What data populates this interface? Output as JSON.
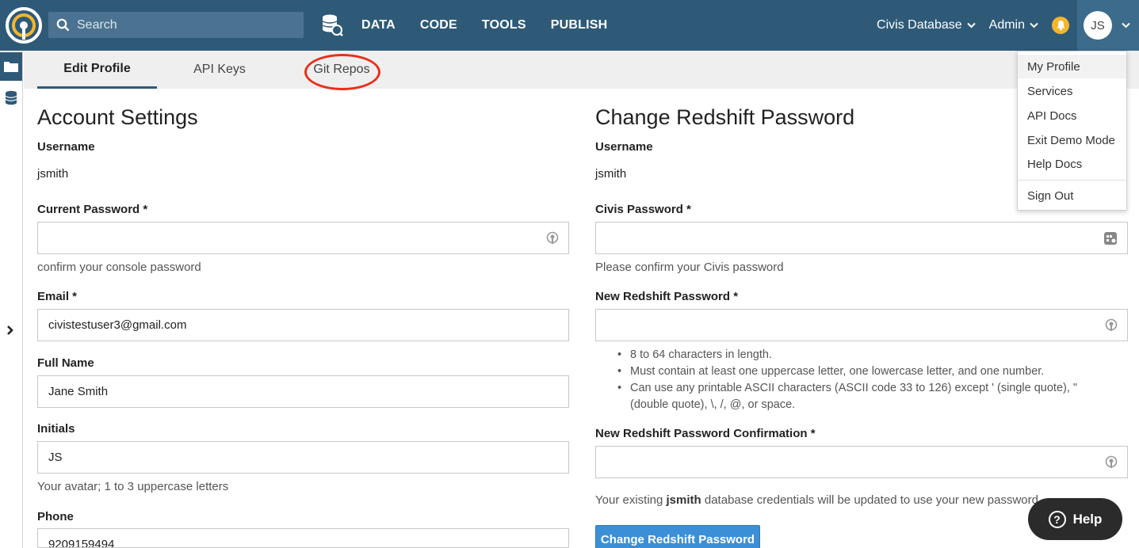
{
  "nav": {
    "search_placeholder": "Search",
    "links": [
      "DATA",
      "CODE",
      "TOOLS",
      "PUBLISH"
    ],
    "database_label": "Civis Database",
    "admin_label": "Admin",
    "avatar_initials": "JS"
  },
  "tabs": [
    "Edit Profile",
    "API Keys",
    "Git Repos"
  ],
  "account": {
    "title": "Account Settings",
    "username_label": "Username",
    "username_value": "jsmith",
    "current_password_label": "Current Password *",
    "current_password_help": "confirm your console password",
    "email_label": "Email *",
    "email_value": "civistestuser3@gmail.com",
    "fullname_label": "Full Name",
    "fullname_value": "Jane Smith",
    "initials_label": "Initials",
    "initials_value": "JS",
    "initials_help": "Your avatar; 1 to 3 uppercase letters",
    "phone_label": "Phone",
    "phone_value": "9209159494"
  },
  "redshift": {
    "title": "Change Redshift Password",
    "username_label": "Username",
    "username_value": "jsmith",
    "civis_password_label": "Civis Password *",
    "civis_password_help": "Please confirm your Civis password",
    "new_password_label": "New Redshift Password *",
    "rules": [
      "8 to 64 characters in length.",
      "Must contain at least one uppercase letter, one lowercase letter, and one number.",
      "Can use any printable ASCII characters (ASCII code 33 to 126) except ' (single quote), \" (double quote), \\, /, @, or space."
    ],
    "confirm_label": "New Redshift Password Confirmation *",
    "notice_prefix": "Your existing ",
    "notice_user": "jsmith",
    "notice_suffix": " database credentials will be updated to use your new password.",
    "submit_label": "Change Redshift Password"
  },
  "dropdown": [
    "My Profile",
    "Services",
    "API Docs",
    "Exit Demo Mode",
    "Help Docs",
    "Sign Out"
  ],
  "help_label": "Help",
  "colors": {
    "nav_bg": "#2e5a78",
    "primary": "#3b8fd6",
    "annotation": "#e8301c",
    "bell": "#f5b62d"
  }
}
